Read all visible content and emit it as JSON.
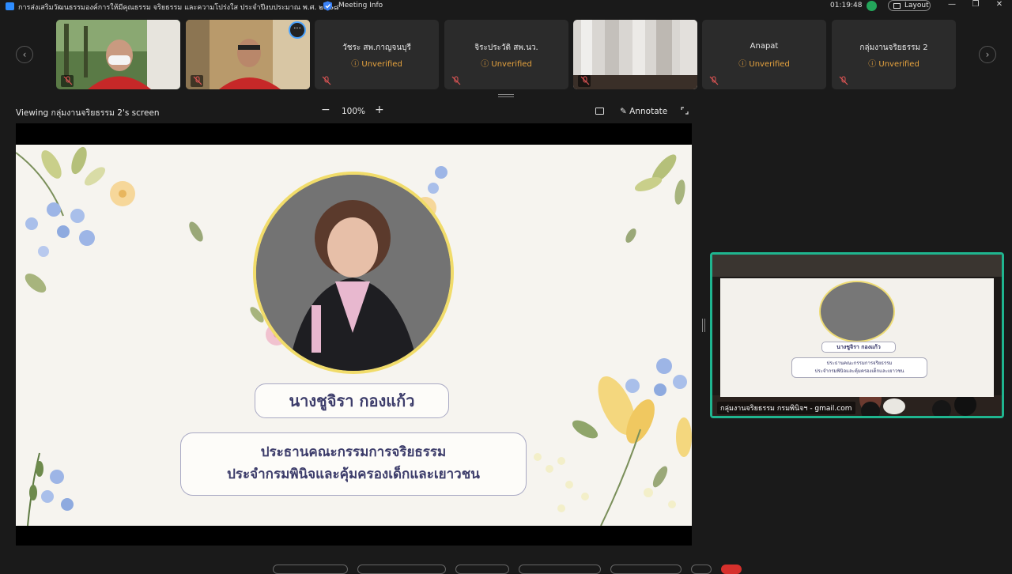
{
  "window": {
    "title": "การส่งเสริมวัฒนธรรมองค์การให้มีคุณธรรม จริยธรรม และความโปร่งใส ประจำปีงบประมาณ พ.ศ. ๒๕๖๘",
    "meeting_info_label": "Meeting Info",
    "timer": "01:19:48",
    "layout_label": "Layout",
    "min_glyph": "—",
    "restore_glyph": "❐",
    "close_glyph": "✕"
  },
  "participants": {
    "prev_glyph": "‹",
    "next_glyph": "›",
    "more_glyph": "···",
    "tiles": [
      {
        "type": "video"
      },
      {
        "type": "video"
      },
      {
        "type": "name",
        "name": "วัชระ สพ.กาญจนบุรี",
        "status": "Unverified"
      },
      {
        "type": "name",
        "name": "จิระประวัติ สพ.นว.",
        "status": "Unverified"
      },
      {
        "type": "video"
      },
      {
        "type": "name",
        "name": "Anapat",
        "status": "Unverified"
      },
      {
        "type": "name",
        "name": "กลุ่มงานจริยธรรม 2",
        "status": "Unverified"
      }
    ],
    "unverified_icon": "ⓘ"
  },
  "share": {
    "viewing_label": "Viewing กลุ่มงานจริยธรรม 2's screen",
    "zoom_minus": "−",
    "zoom_level": "100%",
    "zoom_plus": "+",
    "annotate_label": "Annotate"
  },
  "slide": {
    "person_name": "นางชูจิรา กองแก้ว",
    "position_line1": "ประธานคณะกรรมการจริยธรรม",
    "position_line2": "ประจำกรมพินิจและคุ้มครองเด็กและเยาวชน"
  },
  "side_video": {
    "label": "กลุ่มงานจริยธรรม กรมพินิจฯ - gmail.com",
    "screen_name": "นางชูจิรา กองแก้ว",
    "screen_pos1": "ประธานคณะกรรมการจริยธรรม",
    "screen_pos2": "ประจำกรมพินิจและคุ้มครองเด็กและเยาวชน"
  },
  "colors": {
    "unverified": "#e7a33e",
    "active_speaker": "#1fb58f",
    "accent": "#2d8cff"
  }
}
